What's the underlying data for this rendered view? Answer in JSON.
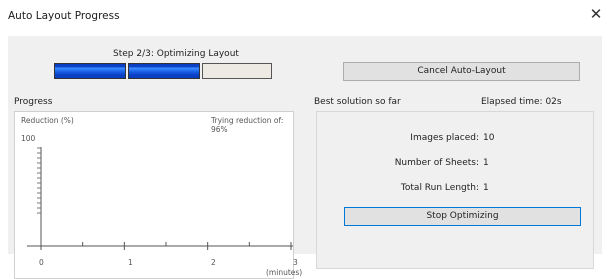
{
  "window": {
    "title": "Auto Layout Progress",
    "close_glyph": "✕"
  },
  "step": {
    "label": "Step 2/3: Optimizing Layout",
    "completed_steps": 2,
    "total_steps": 3
  },
  "buttons": {
    "cancel": "Cancel Auto-Layout",
    "stop": "Stop Optimizing"
  },
  "progress": {
    "section_label": "Progress",
    "ylabel": "Reduction (%)",
    "status": "Trying reduction of: 96%",
    "y_max_label": "100",
    "x_ticks": [
      "0",
      "1",
      "2",
      "3"
    ],
    "x_unit": "(minutes)"
  },
  "best": {
    "section_label": "Best solution so far",
    "elapsed": "Elapsed time: 02s",
    "rows": [
      {
        "label": "Images placed:",
        "value": "10"
      },
      {
        "label": "Number of Sheets:",
        "value": "1"
      },
      {
        "label": "Total Run Length:",
        "value": "1"
      }
    ]
  },
  "colors": {
    "step_fill": "#0a3fc4",
    "focus_border": "#0078d7"
  }
}
